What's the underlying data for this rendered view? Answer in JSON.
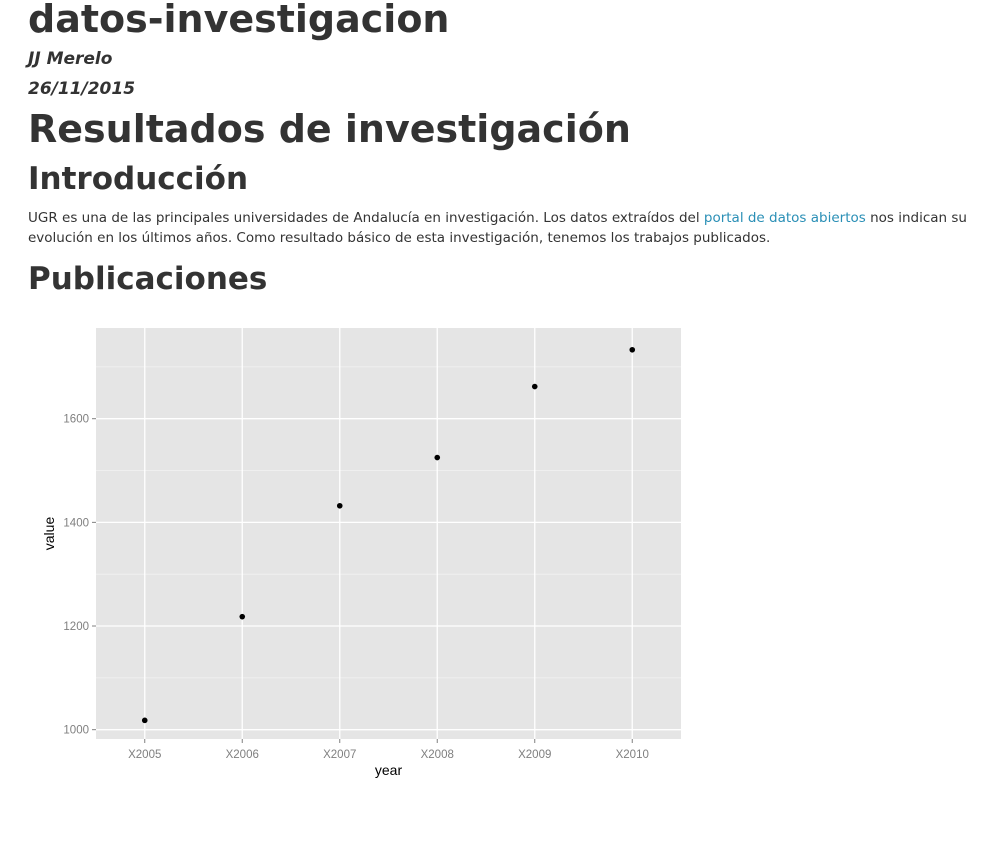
{
  "document": {
    "title": "datos-investigacion",
    "author": "JJ Merelo",
    "date": "26/11/2015"
  },
  "sections": {
    "main_heading": "Resultados de investigación",
    "intro_heading": "Introducción",
    "intro_text_1": "UGR es una de las principales universidades de Andalucía en investigación. Los datos extraídos del ",
    "intro_link": "portal de datos abiertos",
    "intro_text_2": " nos indican su evolución en los últimos años. Como resultado básico de esta investigación, tenemos los trabajos publicados.",
    "publications_heading": "Publicaciones"
  },
  "colors": {
    "text": "#333333",
    "link": "#2a8fb6",
    "panel_background": "#e5e5e5",
    "grid_major": "#ffffff",
    "grid_minor": "#f2f2f2",
    "point": "#000000",
    "tick_label": "#7f7f7f"
  },
  "chart_data": {
    "type": "scatter",
    "categories": [
      "X2005",
      "X2006",
      "X2007",
      "X2008",
      "X2009",
      "X2010"
    ],
    "values": [
      1018,
      1218,
      1432,
      1525,
      1662,
      1733
    ],
    "xlabel": "year",
    "ylabel": "value",
    "ylim": [
      982,
      1775
    ],
    "yticks": [
      1000,
      1200,
      1400,
      1600
    ],
    "grid": true
  }
}
